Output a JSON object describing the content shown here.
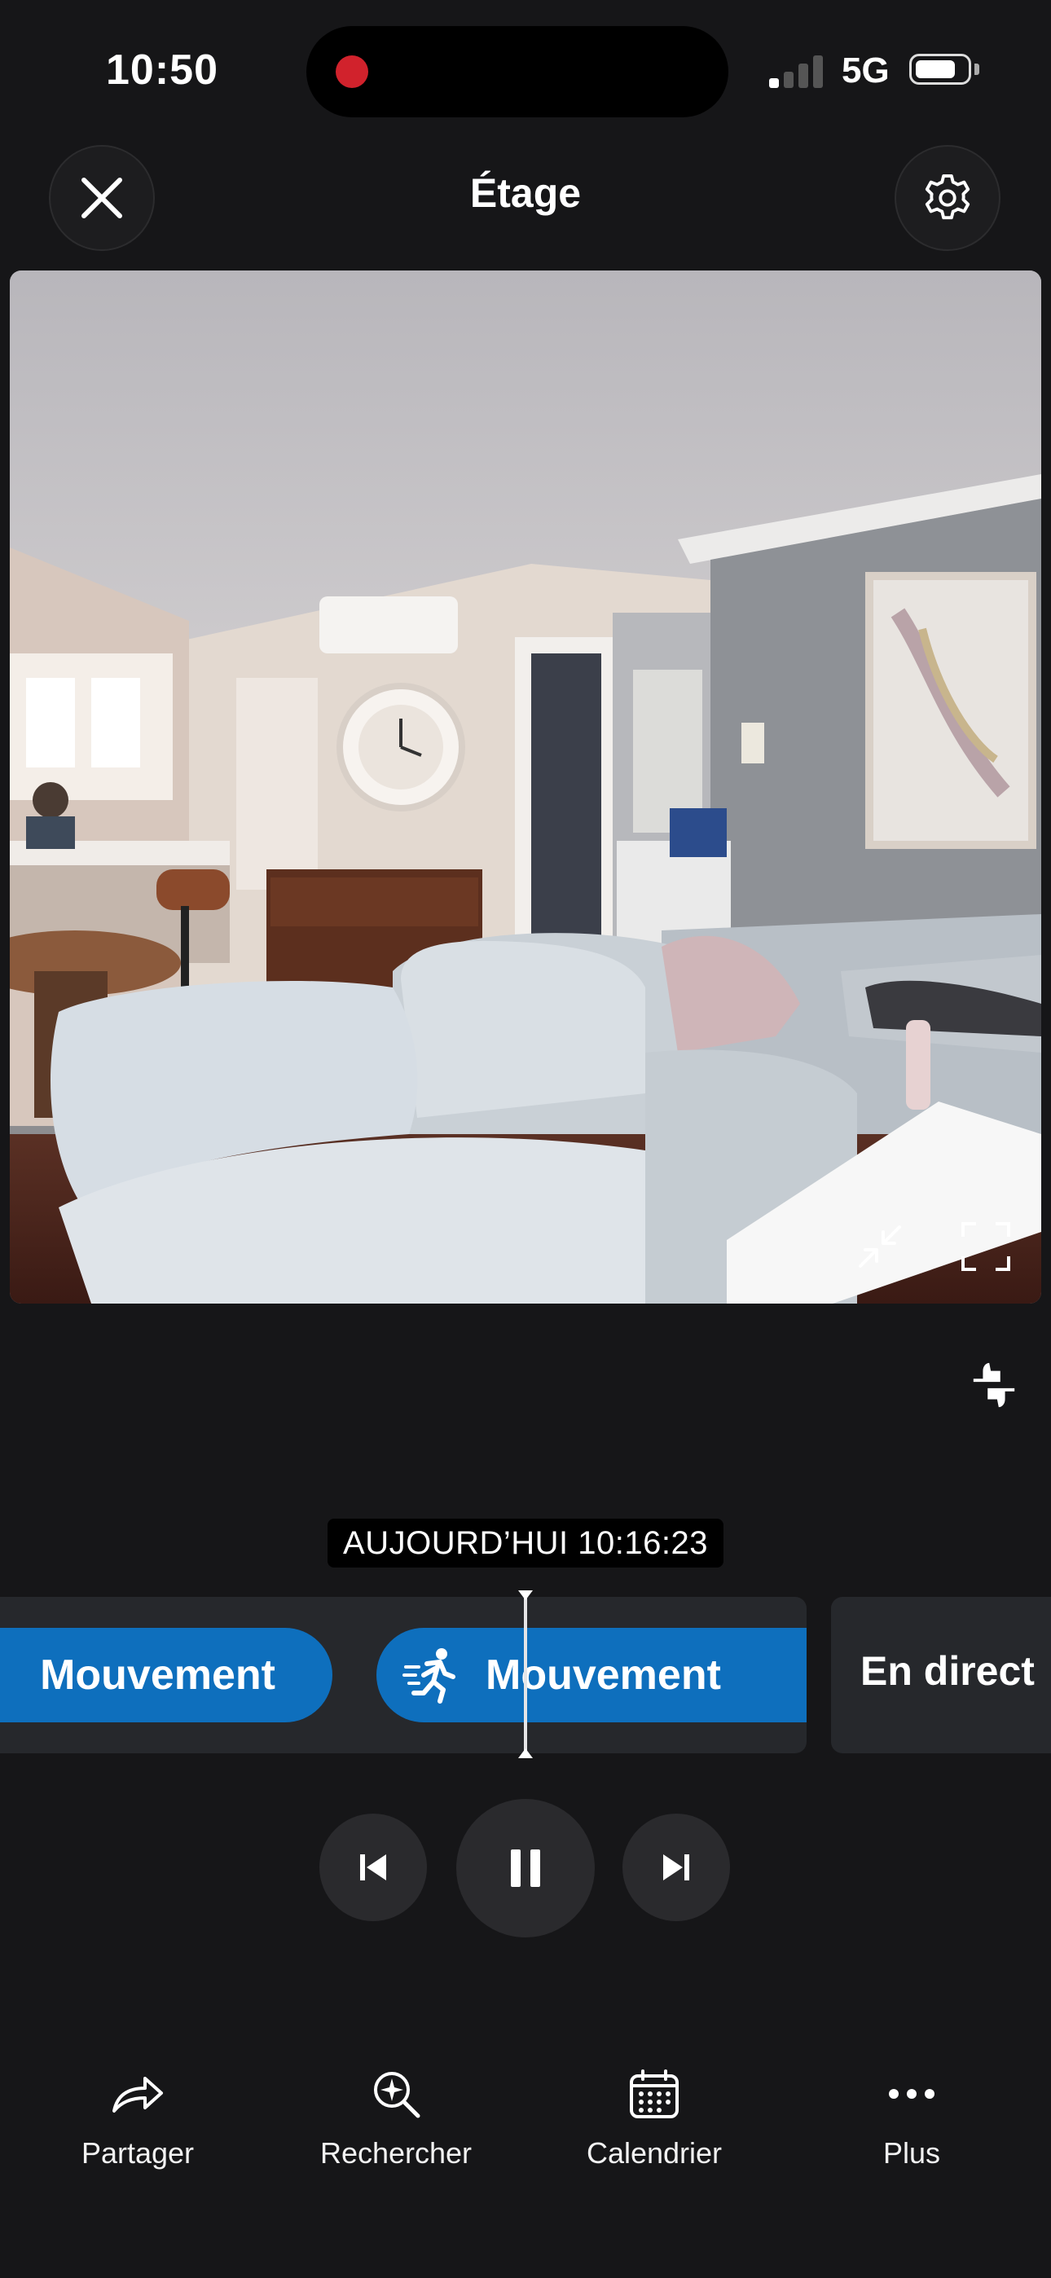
{
  "status_bar": {
    "time": "10:50",
    "network": "5G",
    "recording_indicator_color": "#d1222c",
    "signal_bars_active": 1,
    "signal_bars_total": 4
  },
  "header": {
    "title": "Étage",
    "close_icon": "close-icon",
    "settings_icon": "gear-icon"
  },
  "camera": {
    "view": "living-room-feed",
    "shrink_icon": "shrink-icon",
    "expand_icon": "expand-icon"
  },
  "feedback_icon": "thumbs-feedback-icon",
  "timeline": {
    "timestamp": "AUJOURD’HUI 10:16:23",
    "events": [
      {
        "label": "Mouvement",
        "icon": "running-person-icon"
      },
      {
        "label": "Mouvement",
        "icon": "running-person-icon"
      }
    ],
    "live_label": "En direct",
    "event_color": "#0e6fbd"
  },
  "playback": {
    "prev_icon": "skip-previous-icon",
    "pause_icon": "pause-icon",
    "next_icon": "skip-next-icon"
  },
  "bottom_nav": [
    {
      "label": "Partager",
      "icon": "share-icon"
    },
    {
      "label": "Rechercher",
      "icon": "smart-search-icon"
    },
    {
      "label": "Calendrier",
      "icon": "calendar-icon"
    },
    {
      "label": "Plus",
      "icon": "more-icon"
    }
  ]
}
